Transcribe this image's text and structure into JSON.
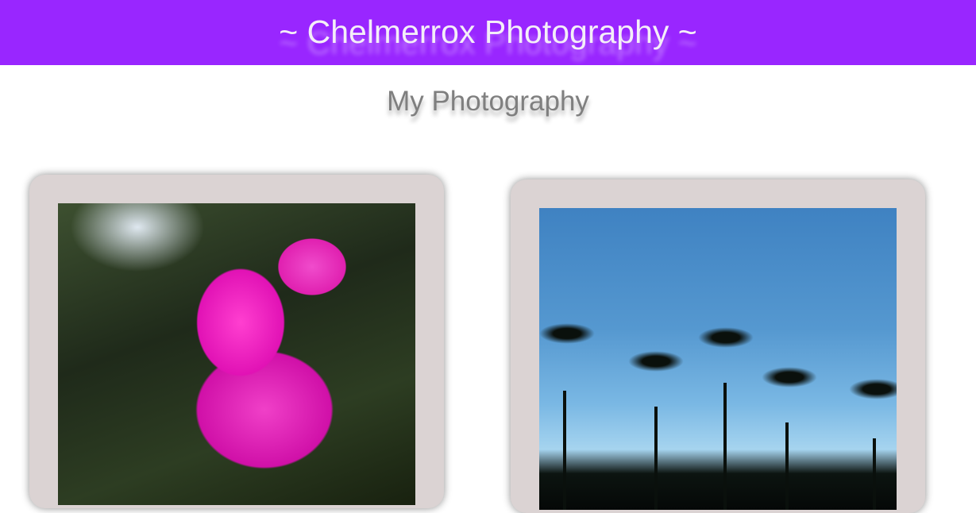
{
  "header": {
    "title": "~ Chelmerrox Photography ~",
    "bg_color": "#9926ff"
  },
  "page": {
    "subtitle": "My Photography"
  },
  "gallery": {
    "photos": [
      {
        "subject": "pink-azalea-flower"
      },
      {
        "subject": "palm-trees-blue-sky"
      }
    ]
  }
}
